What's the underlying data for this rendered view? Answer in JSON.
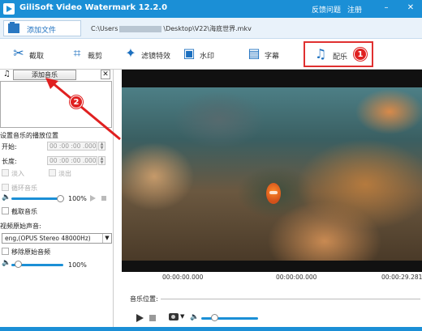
{
  "app": {
    "title": "GiliSoft Video Watermark 12.2.0",
    "feedback": "反馈问题",
    "register": "注册"
  },
  "filebar": {
    "add_file": "添加文件",
    "path_prefix": "C:\\Users",
    "path_suffix": "\\Desktop\\V22\\海底世界.mkv"
  },
  "toolbar": {
    "items": [
      {
        "label": "截取",
        "icon": "scissors-icon"
      },
      {
        "label": "裁剪",
        "icon": "crop-icon"
      },
      {
        "label": "滤镜特效",
        "icon": "magic-wand-icon"
      },
      {
        "label": "水印",
        "icon": "watermark-icon"
      },
      {
        "label": "字幕",
        "icon": "subtitle-icon"
      },
      {
        "label": "配乐",
        "icon": "music-note-icon"
      }
    ],
    "active": "配乐"
  },
  "annotations": {
    "badge1": "1",
    "badge2": "2",
    "color": "#e02020"
  },
  "left": {
    "add_music": "添加音乐",
    "close": "✕",
    "position_heading": "设置音乐的播放位置",
    "start_label": "开始:",
    "start_value": "00 :00 :00 .000",
    "length_label": "长度:",
    "length_value": "00 :00 :00 .000",
    "fade_in": "淡入",
    "fade_out": "淡出",
    "loop": "循环音乐",
    "volume_pct": "100%",
    "trim_music": "截取音乐",
    "orig_audio_label": "视频原始声音:",
    "orig_audio_value": "eng,(OPUS Stereo 48000Hz)",
    "remove_orig": "移除原始音频",
    "volume2_pct": "100%"
  },
  "timeline": {
    "t0": "00:00:00.000",
    "t1": "00:00:00.000",
    "t2": "00:00:29.281",
    "music_pos_label": "音乐位置:"
  },
  "colors": {
    "accent": "#1b8fd6",
    "highlight": "#e03030"
  }
}
